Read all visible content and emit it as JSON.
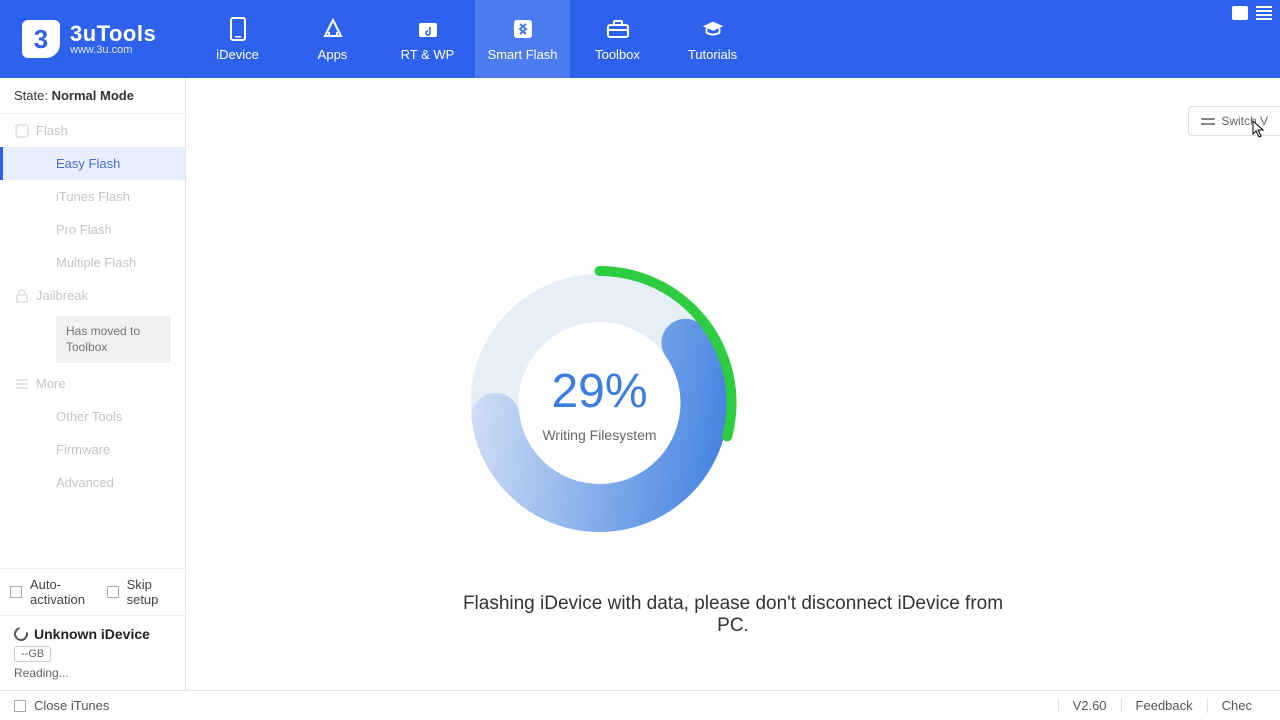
{
  "app": {
    "name": "3uTools",
    "site": "www.3u.com"
  },
  "nav": [
    {
      "label": "iDevice"
    },
    {
      "label": "Apps"
    },
    {
      "label": "RT & WP"
    },
    {
      "label": "Smart Flash"
    },
    {
      "label": "Toolbox"
    },
    {
      "label": "Tutorials"
    }
  ],
  "state": {
    "label": "State:",
    "value": "Normal Mode"
  },
  "sidebar": {
    "flash": "Flash",
    "items": [
      "Easy Flash",
      "iTunes Flash",
      "Pro Flash",
      "Multiple Flash"
    ],
    "jailbreak": "Jailbreak",
    "jb_note": "Has moved to Toolbox",
    "more": "More",
    "more_items": [
      "Other Tools",
      "Firmware",
      "Advanced"
    ],
    "auto": "Auto-activation",
    "skip": "Skip setup"
  },
  "device": {
    "name": "Unknown iDevice",
    "gb": "--GB",
    "reading": "Reading..."
  },
  "switch": "Switch V",
  "progress": {
    "pct": "29%",
    "pct_num": 29,
    "status": "Writing Filesystem"
  },
  "message": "Flashing iDevice with data, please don't disconnect iDevice from PC.",
  "footer": {
    "close": "Close iTunes",
    "ver": "V2.60",
    "feedback": "Feedback",
    "check": "Chec"
  }
}
